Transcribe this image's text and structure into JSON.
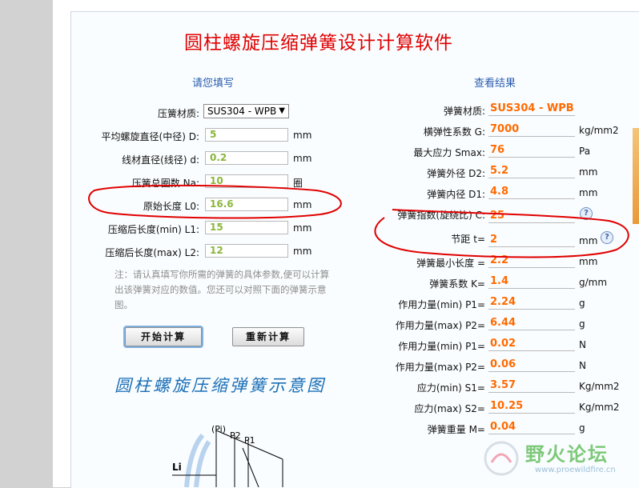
{
  "title": "圆柱螺旋压缩弹簧设计计算软件",
  "input_section": {
    "heading": "请您填写",
    "material_label": "压簧材质:",
    "material_value": "SUS304 - WPB",
    "fields": [
      {
        "label": "平均螺旋直径(中径) D:",
        "value": "5",
        "unit": "mm"
      },
      {
        "label": "线材直径(线径) d:",
        "value": "0.2",
        "unit": "mm"
      },
      {
        "label": "压簧总圈数 Na:",
        "value": "10",
        "unit": "圈"
      },
      {
        "label": "原始长度 L0:",
        "value": "16.6",
        "unit": "mm"
      },
      {
        "label": "压缩后长度(min) L1:",
        "value": "15",
        "unit": "mm"
      },
      {
        "label": "压缩后长度(max) L2:",
        "value": "12",
        "unit": "mm"
      }
    ],
    "note": "注：请认真填写你所需的弹簧的具体参数,便可以计算出该弹簧对应的数值。您还可以对照下面的弹簧示意图。",
    "calc_button": "开始计算",
    "reset_button": "重新计算",
    "diagram_title": "圆柱螺旋压缩弹簧示意图",
    "diagram_labels": {
      "pi": "(Pi)",
      "p2": "P2",
      "p1": "P1",
      "li": "Li"
    }
  },
  "result_section": {
    "heading": "查看结果",
    "rows": [
      {
        "label": "弹簧材质:",
        "value": "SUS304 - WPB",
        "unit": ""
      },
      {
        "label": "横弹性系数 G:",
        "value": "7000",
        "unit": "kg/mm2"
      },
      {
        "label": "最大应力 Smax:",
        "value": "76",
        "unit": "Pa"
      },
      {
        "label": "弹簧外径 D2:",
        "value": "5.2",
        "unit": "mm"
      },
      {
        "label": "弹簧内径 D1:",
        "value": "4.8",
        "unit": "mm"
      },
      {
        "label": "弹簧指数(旋绕比) C:",
        "value": "25",
        "unit": ""
      },
      {
        "label": "节距 t=",
        "value": "2",
        "unit": "mm"
      },
      {
        "label": "弹簧最小长度 =",
        "value": "2.2",
        "unit": "mm"
      },
      {
        "label": "弹簧系数 K=",
        "value": "1.4",
        "unit": "g/mm"
      },
      {
        "label": "作用力量(min) P1=",
        "value": "2.24",
        "unit": "g"
      },
      {
        "label": "作用力量(max) P2=",
        "value": "6.44",
        "unit": "g"
      },
      {
        "label": "作用力量(min) P1=",
        "value": "0.02",
        "unit": "N"
      },
      {
        "label": "作用力量(max) P2=",
        "value": "0.06",
        "unit": "N"
      },
      {
        "label": "应力(min) S1=",
        "value": "3.57",
        "unit": "Kg/mm2"
      },
      {
        "label": "应力(max) S2=",
        "value": "10.25",
        "unit": "Kg/mm2"
      },
      {
        "label": "弹簧重量 M=",
        "value": "0.04",
        "unit": "g"
      }
    ],
    "help_icon": "?"
  },
  "watermark": {
    "text": "野火论坛",
    "url": "www.proewildfire.cn"
  },
  "colors": {
    "title": "#e00000",
    "heading": "#2a5db0",
    "input_value": "#8ab53a",
    "result_value": "#ff6a00",
    "annotation": "#e00000"
  }
}
